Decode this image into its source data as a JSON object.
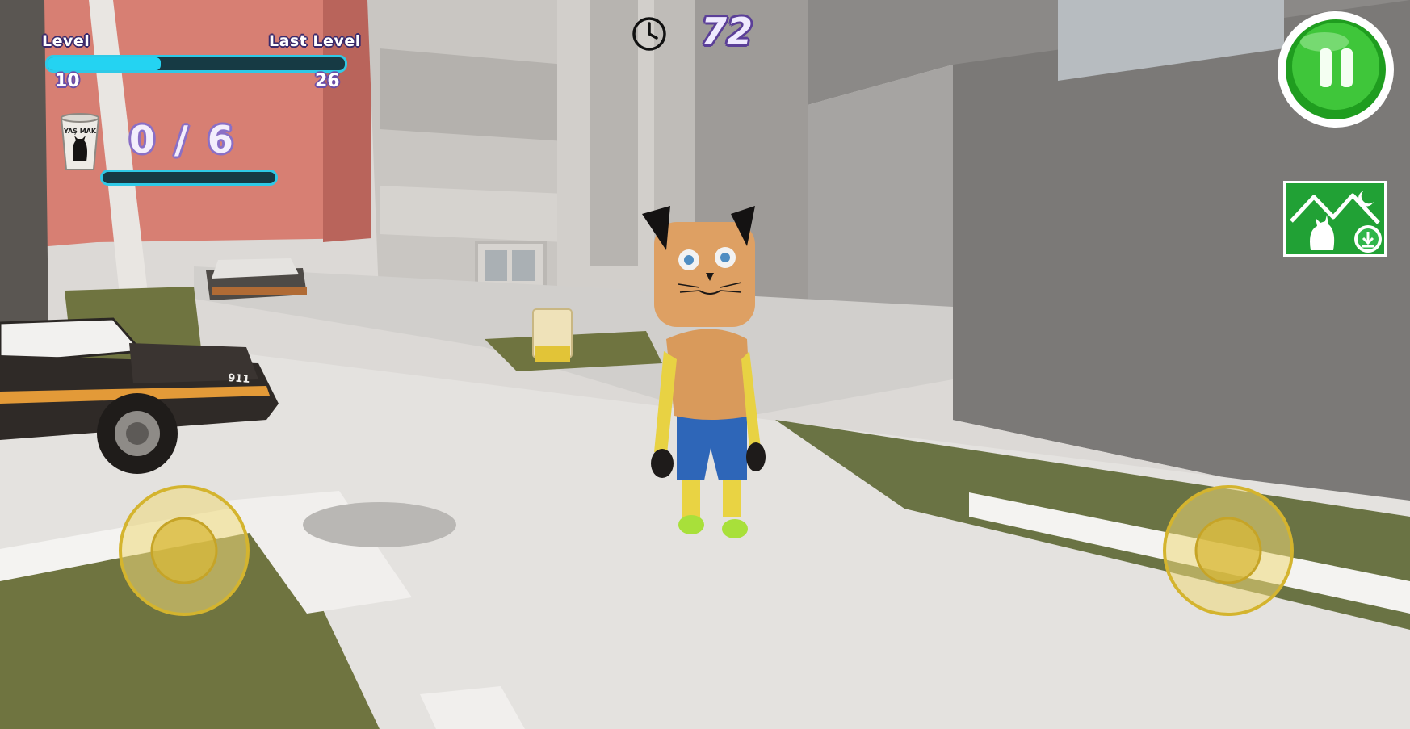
{
  "hud": {
    "level_label": "Level",
    "last_level_label": "Last Level",
    "current_level": "10",
    "last_level": "26",
    "level_progress": 0.38,
    "timer_value": "72",
    "collected_count": "0 / 6",
    "collected_progress": 0,
    "collectible_label": "YAŞ MAK"
  },
  "scene": {
    "car_plate": "911"
  },
  "icons": {
    "timer": "clock-icon",
    "pause": "pause-icon",
    "home": "home-cat-icon",
    "collectible": "cup-icon",
    "left_joystick": "move-joystick",
    "right_joystick": "camera-joystick"
  },
  "colors": {
    "bar_fill": "#24d3f2",
    "pause_green": "#2fb52c",
    "home_green": "#24a33a",
    "joystick": "#e8c84a"
  }
}
